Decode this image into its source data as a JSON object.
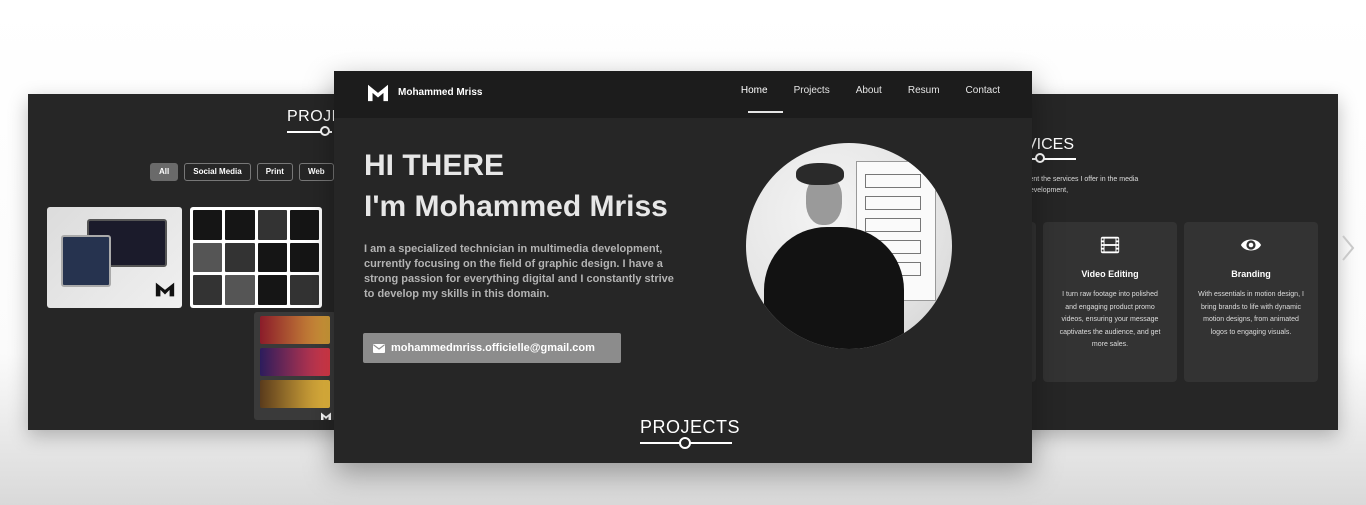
{
  "left_card": {
    "section_title": "PROJE",
    "filters": [
      "All",
      "Social Media",
      "Print",
      "Web",
      ""
    ],
    "active_filter": "All"
  },
  "right_card": {
    "section_title": "VICES",
    "intro": "sent the services I offer in the media development,",
    "services": [
      {
        "icon": "film-icon",
        "title": "Video Editing",
        "text": "I turn raw footage into polished and engaging product promo videos, ensuring your message captivates the audience, and get more sales."
      },
      {
        "icon": "eye-icon",
        "title": "Branding",
        "text": "With essentials in motion design, I bring brands to life with dynamic motion designs, from animated logos to engaging visuals."
      }
    ]
  },
  "front": {
    "brand": "Mohammed Mriss",
    "nav": [
      "Home",
      "Projects",
      "About",
      "Resum",
      "Contact"
    ],
    "active_nav": "Home",
    "hero_line1": "HI THERE",
    "hero_line2": "I'm Mohammed Mriss",
    "bio": "I am a specialized technician in multimedia development, currently focusing on the field of graphic design. I have a strong passion for everything digital and I constantly strive to develop my skills in this domain.",
    "email": "mohammedmriss.officielle@gmail.com",
    "projects_heading": "PROJECTS"
  },
  "icons": {
    "mail": "mail-icon",
    "next": "chevron-right-icon"
  }
}
